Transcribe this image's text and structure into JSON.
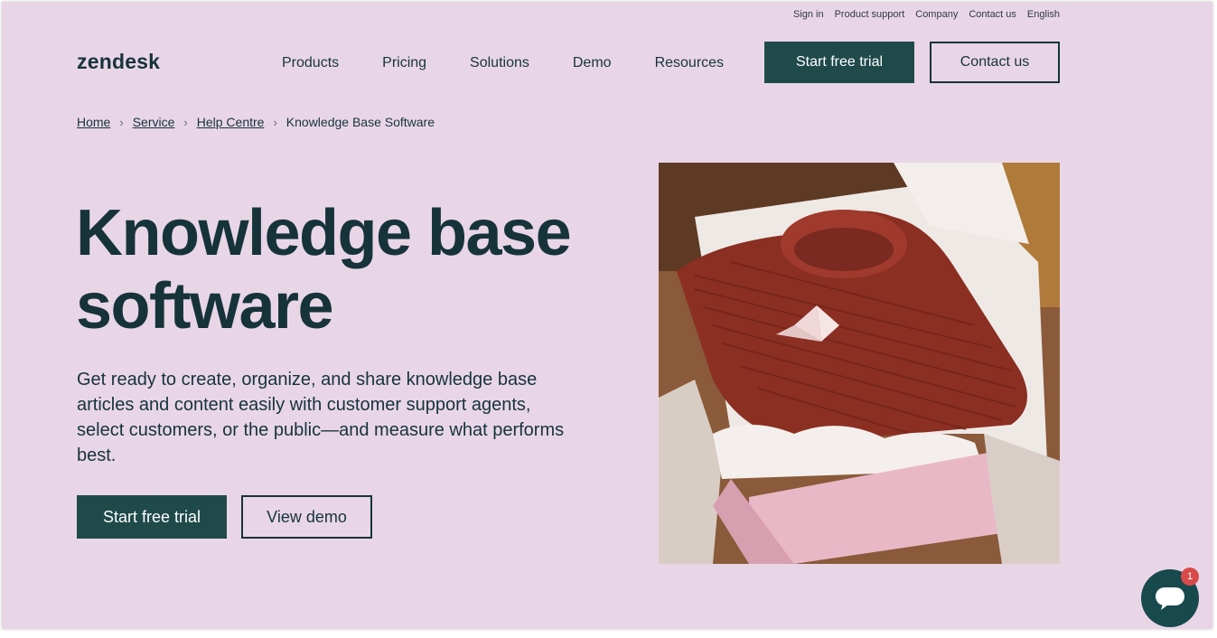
{
  "utility_nav": {
    "items": [
      "Sign in",
      "Product support",
      "Company",
      "Contact us",
      "English"
    ]
  },
  "header": {
    "logo": "zendesk",
    "nav": [
      "Products",
      "Pricing",
      "Solutions",
      "Demo",
      "Resources"
    ],
    "trial_label": "Start free trial",
    "contact_label": "Contact us"
  },
  "breadcrumb": {
    "items": [
      "Home",
      "Service",
      "Help Centre"
    ],
    "current": "Knowledge Base Software"
  },
  "hero": {
    "title_line1": "Knowledge base",
    "title_line2": "software",
    "description": "Get ready to create, organize, and share knowledge base articles and content easily with customer support agents, select customers, or the public—and measure what performs best.",
    "trial_label": "Start free trial",
    "demo_label": "View demo"
  },
  "chat": {
    "icon": "chat-bubble-icon",
    "badge_count": "1"
  },
  "colors": {
    "background": "#e8d6e7",
    "primary": "#204a4a",
    "text": "#17333a"
  }
}
